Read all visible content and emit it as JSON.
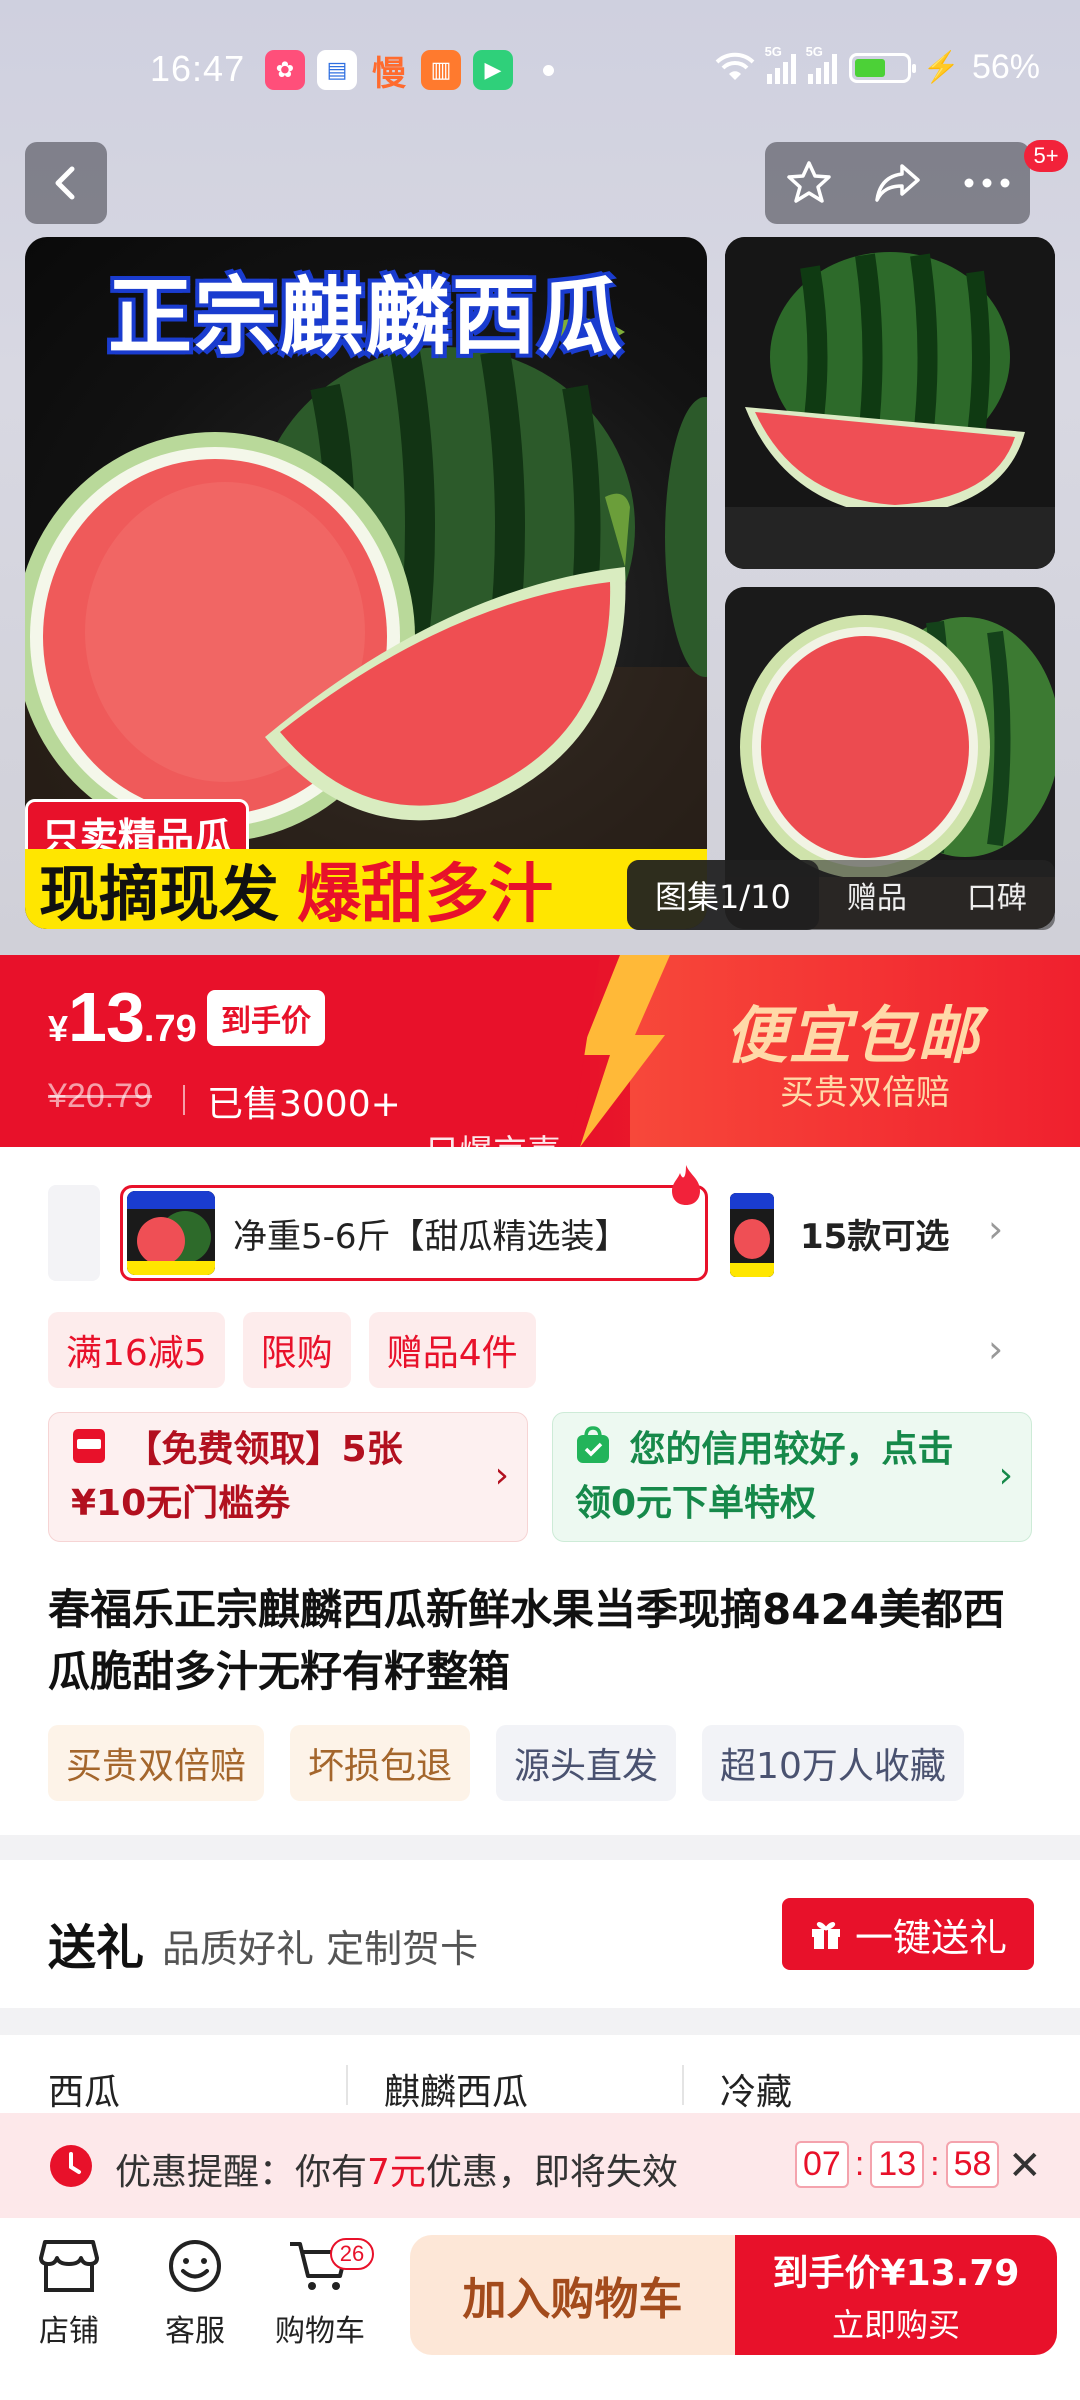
{
  "status": {
    "time": "16:47",
    "network1": "5G",
    "network2": "5G",
    "battery": "56%"
  },
  "header": {
    "badge": "5+"
  },
  "images": {
    "main_title": "正宗麒麟西瓜",
    "main_tag": "只卖精品瓜",
    "main_slogan_a": "现摘现发",
    "main_slogan_b": "爆甜多汁",
    "gallery_tab": "图集1/10",
    "gift_tab": "赠品",
    "review_tab": "口碑"
  },
  "price": {
    "currency": "¥",
    "integer": "13",
    "decimal": ".79",
    "badge": "到手价",
    "original": "¥20.79",
    "sold": "已售3000+",
    "slogan": "便宜包邮",
    "guarantee": "买贵双倍赔",
    "watermark": "只爆京喜"
  },
  "sku": {
    "selected": "净重5-6斤【甜瓜精选装】",
    "count": "15款可选"
  },
  "promos": [
    "满16减5",
    "限购",
    "赠品4件"
  ],
  "coupons": {
    "left": "【免费领取】5张¥10无门槛券",
    "right": "您的信用较好，点击领0元下单特权"
  },
  "product": {
    "title": "春福乐正宗麒麟西瓜新鲜水果当季现摘8424美都西瓜脆甜多汁无籽有籽整箱",
    "features": [
      "买贵双倍赔",
      "坏损包退",
      "源头直发",
      "超10万人收藏"
    ]
  },
  "gift": {
    "title": "送礼",
    "subtitle": "品质好礼 定制贺卡",
    "button": "一键送礼"
  },
  "categories": [
    "西瓜",
    "麒麟西瓜",
    "冷藏"
  ],
  "reminder": {
    "prefix": "优惠提醒：你有",
    "amount": "7元",
    "suffix": "优惠，即将失效",
    "hh": "07",
    "mm": "13",
    "ss": "58"
  },
  "bottom": {
    "store": "店铺",
    "service": "客服",
    "cart": "购物车",
    "cart_count": "26",
    "add_cart": "加入购物车",
    "buy_price": "到手价¥13.79",
    "buy_now": "立即购买"
  },
  "colors": {
    "brand_red": "#e8112a",
    "green": "#16894a"
  }
}
